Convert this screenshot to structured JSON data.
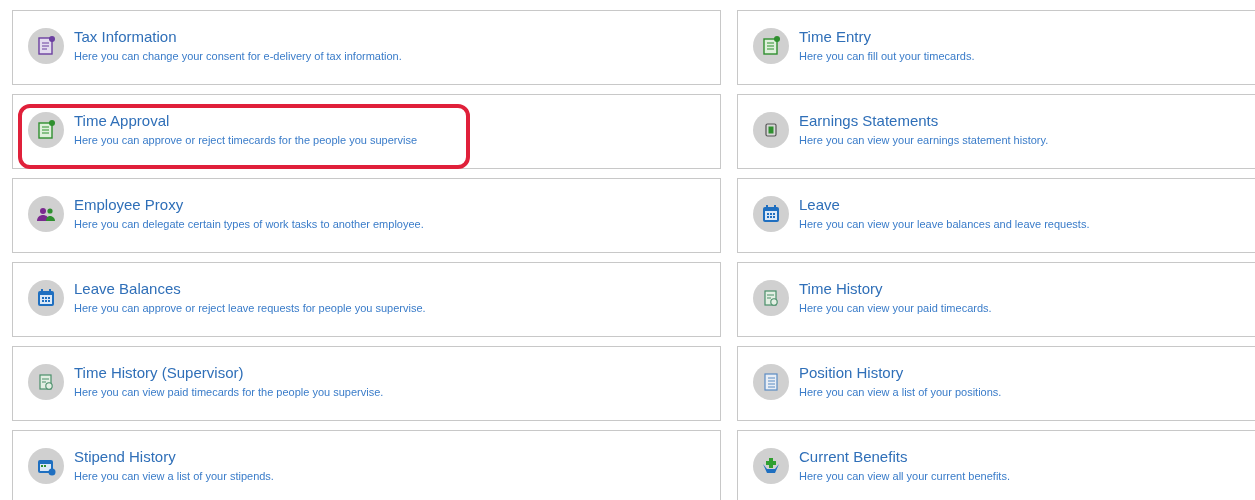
{
  "tiles": [
    {
      "title": "Tax Information",
      "description": "Here you can change your consent for e-delivery of tax information.",
      "kind": "tax",
      "highlighted": false
    },
    {
      "title": "Time Entry",
      "description": "Here you can fill out your timecards.",
      "kind": "timesheet",
      "highlighted": false
    },
    {
      "title": "Time Approval",
      "description": "Here you can approve or reject timecards for the people you supervise",
      "kind": "timesheet",
      "highlighted": true
    },
    {
      "title": "Earnings Statements",
      "description": "Here you can view your earnings statement history.",
      "kind": "earnings",
      "highlighted": false
    },
    {
      "title": "Employee Proxy",
      "description": "Here you can delegate certain types of work tasks to another employee.",
      "kind": "people",
      "highlighted": false
    },
    {
      "title": "Leave",
      "description": "Here you can view your leave balances and leave requests.",
      "kind": "calendar",
      "highlighted": false
    },
    {
      "title": "Leave Balances",
      "description": "Here you can approve or reject leave requests for people you supervise.",
      "kind": "calendar",
      "highlighted": false
    },
    {
      "title": "Time History",
      "description": "Here you can view your paid timecards.",
      "kind": "history",
      "highlighted": false
    },
    {
      "title": "Time History (Supervisor)",
      "description": "Here you can view paid timecards for the people you supervise.",
      "kind": "history",
      "highlighted": false
    },
    {
      "title": "Position History",
      "description": "Here you can view a list of your positions.",
      "kind": "list",
      "highlighted": false
    },
    {
      "title": "Stipend History",
      "description": "Here you can view a list of your stipends.",
      "kind": "stipend",
      "highlighted": false
    },
    {
      "title": "Current Benefits",
      "description": "Here you can view all your current benefits.",
      "kind": "benefits",
      "highlighted": false
    }
  ]
}
